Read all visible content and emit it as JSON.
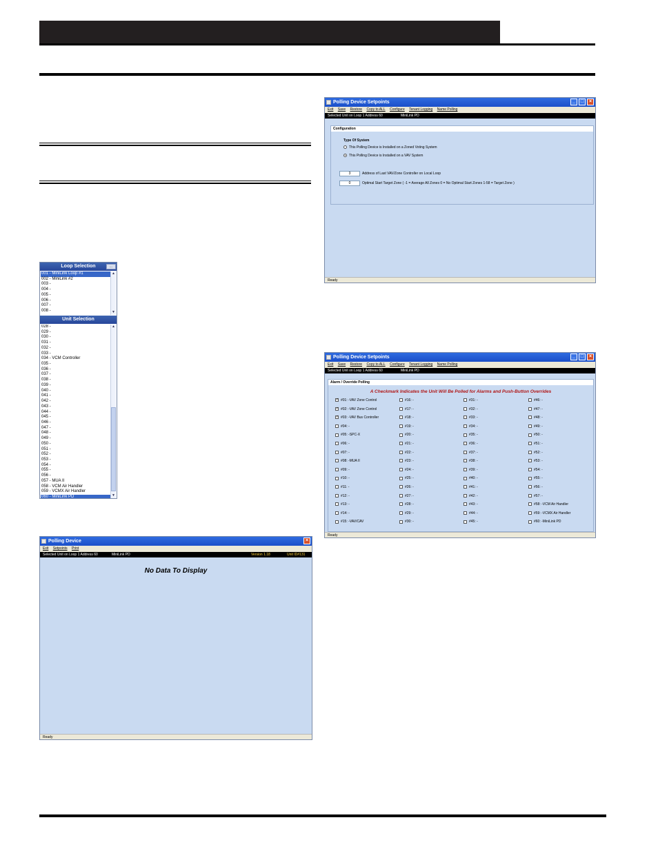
{
  "loop_selection": {
    "title": "Loop Selection",
    "items": [
      "001 - MiniLink Loop #1",
      "002 - MiniLink #2",
      "003 -",
      "004 -",
      "005 -",
      "006 -",
      "007 -",
      "008 -"
    ]
  },
  "unit_selection": {
    "title": "Unit Selection",
    "items": [
      "028 -",
      "029 -",
      "030 -",
      "031 -",
      "032 -",
      "033 -",
      "034 - VCM Controller",
      "035 -",
      "036 -",
      "037 -",
      "038 -",
      "039 -",
      "040 -",
      "041 -",
      "042 -",
      "043 -",
      "044 -",
      "045 -",
      "046 -",
      "047 -",
      "048 -",
      "049 -",
      "050 -",
      "051 -",
      "052 -",
      "053 -",
      "054 -",
      "055 -",
      "056 -",
      "057 - MUA II",
      "058 - VCM Air Handler",
      "059 - VCMX Air Handler",
      "060 - MiniLink PD"
    ]
  },
  "polling_device": {
    "title": "Polling Device",
    "menu": [
      "Exit",
      "Setpoints",
      "Print"
    ],
    "info_left": "Selected Unit on Loop 1 Address 60",
    "info_unit": "MiniLink PD",
    "version": "Version 1.18",
    "unit_id": "Unit ID#131",
    "message": "No Data To Display",
    "status": "Ready"
  },
  "setpoints_config": {
    "title": "Polling Device Setpoints",
    "menu": [
      "Exit",
      "Save",
      "Restore",
      "Copy to ALL",
      "Configure",
      "Tenant Logging",
      "Name Polling"
    ],
    "info_left": "Selected Unit on Loop 1 Address 60",
    "info_unit": "MiniLink PD",
    "group_title": "Configuration",
    "type_title": "Type Of System",
    "option_zoned": "This Polling Device is Installed on a Zoned Voting System",
    "option_vav": "This Polling Device is Installed on a VAV System",
    "last_addr_value": "3",
    "last_addr_label": "Address of Last VAV/Zone Controller on Local Loop",
    "opt_start_value": "0",
    "opt_start_label": "Optimal Start Target Zone   ( -1 = Average All Zones   0 = No Optimal Start Zones   1-58 = Target Zone )",
    "status": "Ready"
  },
  "setpoints_alarm": {
    "title": "Polling Device Setpoints",
    "menu": [
      "Exit",
      "Save",
      "Restore",
      "Copy to ALL",
      "Configure",
      "Tenant Logging",
      "Name Polling"
    ],
    "info_left": "Selected Unit on Loop 1 Address 60",
    "info_unit": "MiniLink PD",
    "group_title": "Alarm / Override Polling",
    "heading": "A Checkmark Indicates the Unit Will Be Polled for Alarms and Push-Button Overrides",
    "columns": [
      [
        "#01: -VAV Zone Control",
        "#02: -VAV Zone Control",
        "#03: -VAV Bus Controller",
        "#04: -",
        "#05: -SPC-X",
        "#06: -",
        "#07: -",
        "#08: -MUA II",
        "#09: -",
        "#10: -",
        "#11: -",
        "#12: -",
        "#13: -",
        "#14: -",
        "#15: -VAV/CAV"
      ],
      [
        "#16: -",
        "#17: -",
        "#18: -",
        "#19: -",
        "#20: -",
        "#21: -",
        "#22: -",
        "#23: -",
        "#24: -",
        "#25: -",
        "#26: -",
        "#27: -",
        "#28: -",
        "#29: -",
        "#30: -"
      ],
      [
        "#31: -",
        "#32: -",
        "#33: -",
        "#34: -",
        "#35: -",
        "#36: -",
        "#37: -",
        "#38: -",
        "#39: -",
        "#40: -",
        "#41: -",
        "#42: -",
        "#43: -",
        "#44: -",
        "#45: -"
      ],
      [
        "#46: -",
        "#47: -",
        "#48: -",
        "#49: -",
        "#50: -",
        "#51: -",
        "#52: -",
        "#53: -",
        "#54: -",
        "#55: -",
        "#56: -",
        "#57: -",
        "#58: -VCM Air Handler",
        "#59: -VCMX Air Handler",
        "#60: -MiniLink PD"
      ]
    ],
    "checked": [
      "#01",
      "#02",
      "#03"
    ],
    "status": "Ready"
  },
  "colors": {
    "window_bg": "#c9daf1",
    "title_blue": "#1b4fc9",
    "heading_red": "#b01515",
    "header_bar": "#231f20"
  }
}
